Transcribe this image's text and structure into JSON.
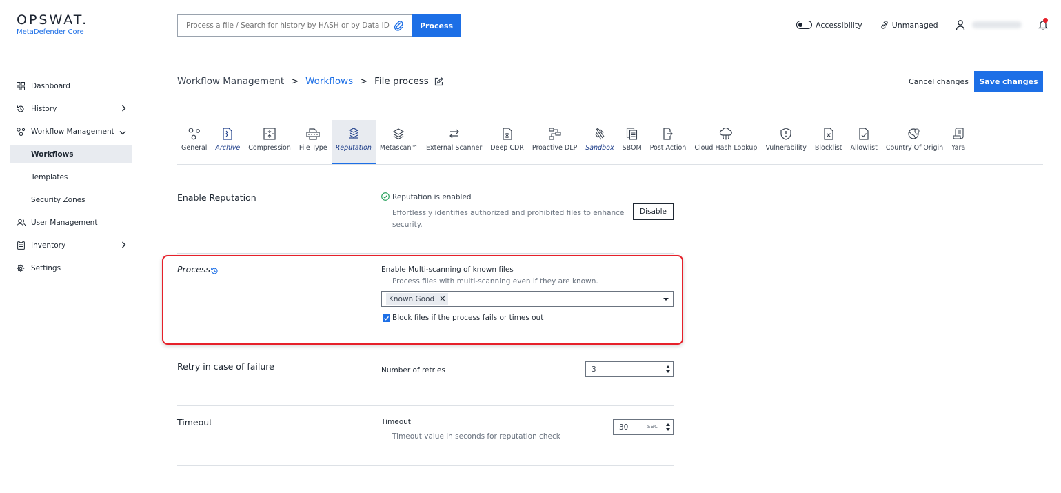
{
  "logo": {
    "brand": "OPSWAT.",
    "product": "MetaDefender Core"
  },
  "search": {
    "placeholder": "Process a file / Search for history by HASH or by Data ID",
    "button": "Process"
  },
  "topbar": {
    "accessibility": "Accessibility",
    "unmanaged": "Unmanaged"
  },
  "sidebar": {
    "dashboard": "Dashboard",
    "history": "History",
    "workflow_management": "Workflow Management",
    "workflows": "Workflows",
    "templates": "Templates",
    "security_zones": "Security Zones",
    "user_management": "User Management",
    "inventory": "Inventory",
    "settings": "Settings"
  },
  "breadcrumb": {
    "root": "Workflow Management",
    "sep1": ">",
    "link": "Workflows",
    "sep2": ">",
    "current": "File process"
  },
  "actions": {
    "cancel": "Cancel changes",
    "save": "Save changes"
  },
  "tabs": [
    {
      "label": "General"
    },
    {
      "label": "Archive"
    },
    {
      "label": "Compression"
    },
    {
      "label": "File Type"
    },
    {
      "label": "Reputation"
    },
    {
      "label": "Metascan™"
    },
    {
      "label": "External Scanner"
    },
    {
      "label": "Deep CDR"
    },
    {
      "label": "Proactive DLP"
    },
    {
      "label": "Sandbox"
    },
    {
      "label": "SBOM"
    },
    {
      "label": "Post Action"
    },
    {
      "label": "Cloud Hash Lookup"
    },
    {
      "label": "Vulnerability"
    },
    {
      "label": "Blocklist"
    },
    {
      "label": "Allowlist"
    },
    {
      "label": "Country Of Origin"
    },
    {
      "label": "Yara"
    }
  ],
  "reputation": {
    "title": "Enable Reputation",
    "status": "Reputation is enabled",
    "desc_line1": "Effortlessly identifies authorized and prohibited files to enhance",
    "desc_line2": "security.",
    "disable": "Disable"
  },
  "process": {
    "title": "Process",
    "label": "Enable Multi-scanning of known files",
    "desc": "Process files with multi-scanning even if they are known.",
    "chip": "Known Good",
    "chip_remove": "✕",
    "block_label": "Block files if the process fails or times out",
    "block_checked": true
  },
  "retry": {
    "title": "Retry in case of failure",
    "label": "Number of retries",
    "value": "3"
  },
  "timeout": {
    "title": "Timeout",
    "label": "Timeout",
    "desc": "Timeout value in seconds for reputation check",
    "value": "30",
    "unit": "sec"
  }
}
